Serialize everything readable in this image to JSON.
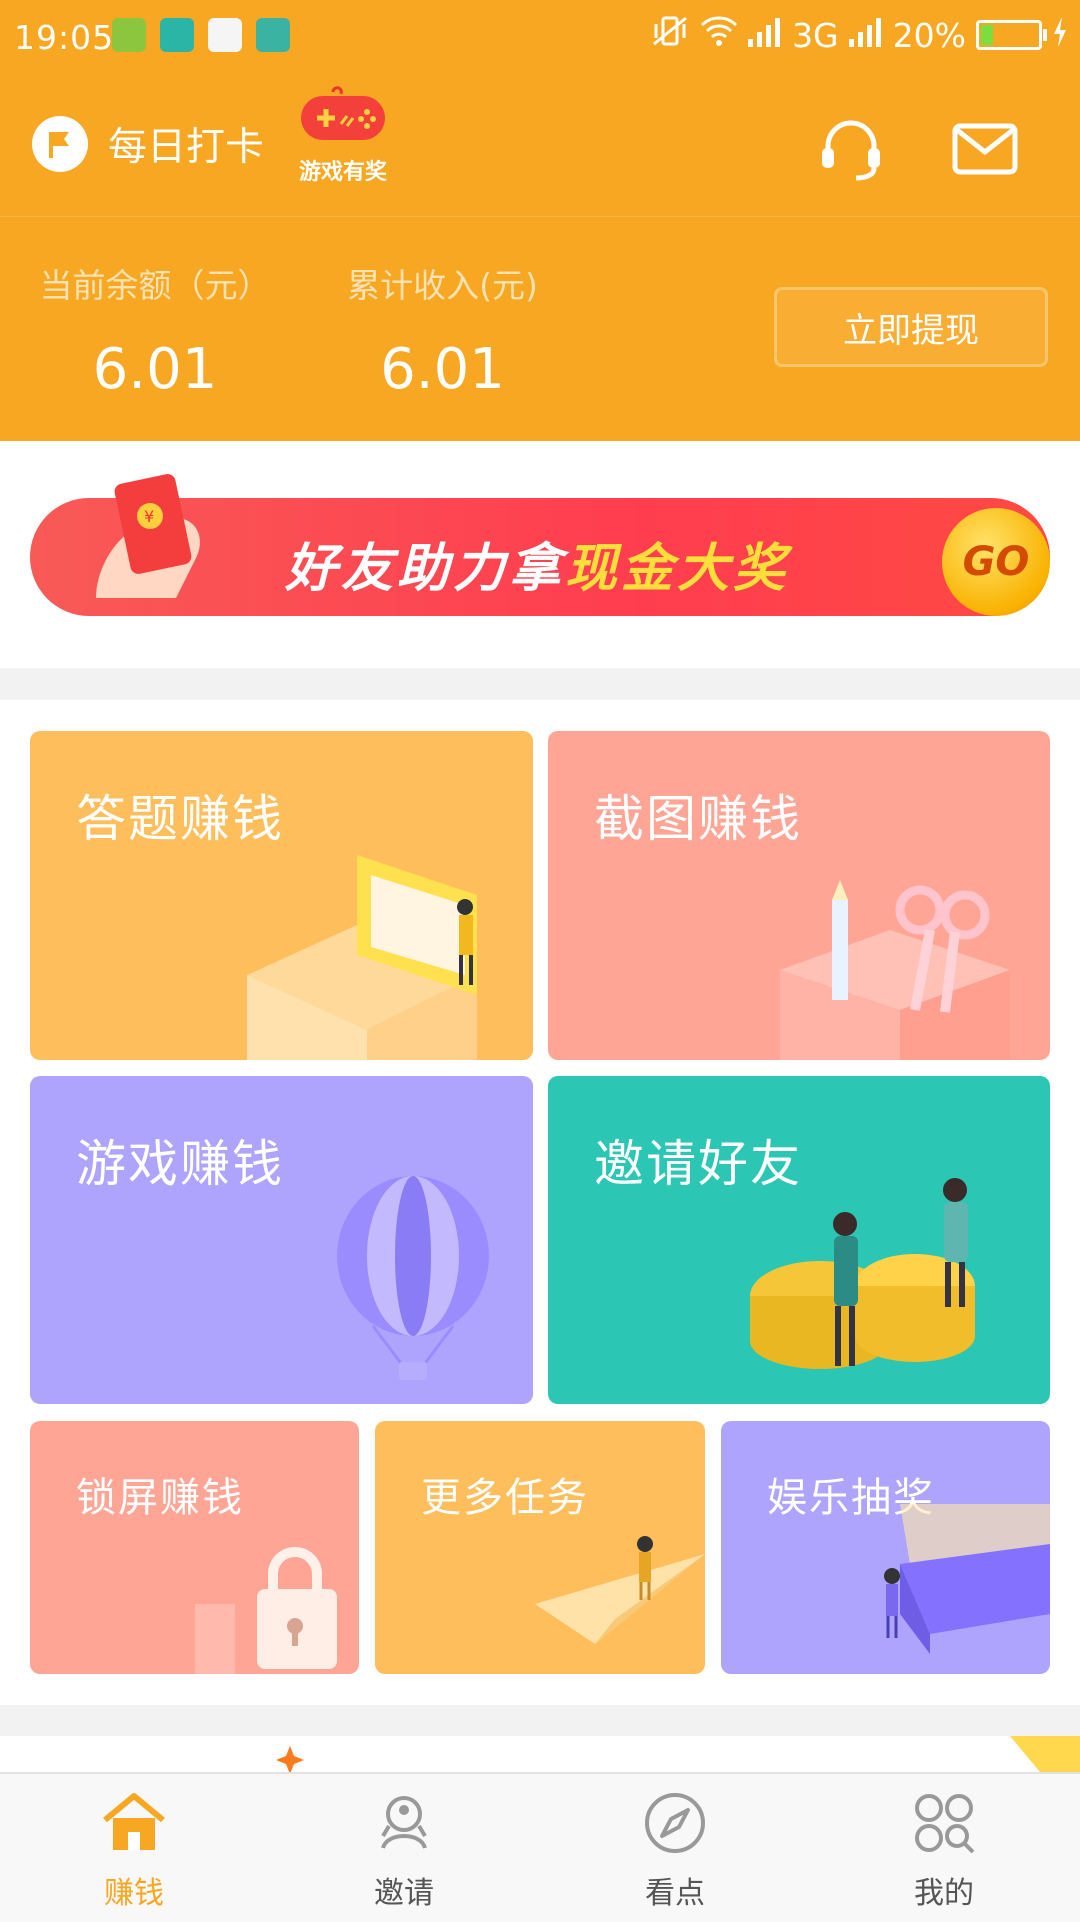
{
  "status_bar": {
    "time": "19:05",
    "network": "3G",
    "battery": "20%",
    "battery_level": 0.2,
    "notification_icons": [
      "shield-icon",
      "screenshot-icon",
      "sogou-icon",
      "usb-icon"
    ]
  },
  "header": {
    "checkin_label": "每日打卡",
    "game_prize_label": "游戏有奖",
    "icons": [
      "flag-icon",
      "gamepad-icon",
      "headset-icon",
      "mail-icon"
    ]
  },
  "balance": {
    "current_label": "当前余额（元）",
    "current_value": "6.01",
    "total_label": "累计收入(元)",
    "total_value": "6.01",
    "withdraw_label": "立即提现"
  },
  "banner": {
    "text_prefix": "好友助力拿",
    "text_highlight": "现金大奖",
    "go_label": "GO"
  },
  "tiles": [
    {
      "label": "答题赚钱",
      "color": "#FFBE5C"
    },
    {
      "label": "截图赚钱",
      "color": "#FFA596"
    },
    {
      "label": "游戏赚钱",
      "color": "#AFA4FD"
    },
    {
      "label": "邀请好友",
      "color": "#2BC6B4"
    },
    {
      "label": "锁屏赚钱",
      "color": "#FFA596"
    },
    {
      "label": "更多任务",
      "color": "#FFBE5C"
    },
    {
      "label": "娱乐抽奖",
      "color": "#AFA4FD"
    }
  ],
  "tabbar": [
    {
      "label": "赚钱",
      "icon": "home-icon",
      "active": true
    },
    {
      "label": "邀请",
      "icon": "invite-icon",
      "active": false
    },
    {
      "label": "看点",
      "icon": "compass-icon",
      "active": false
    },
    {
      "label": "我的",
      "icon": "grid-icon",
      "active": false
    }
  ],
  "colors": {
    "brand": "#F8A722",
    "active_tab": "#F8A722"
  }
}
